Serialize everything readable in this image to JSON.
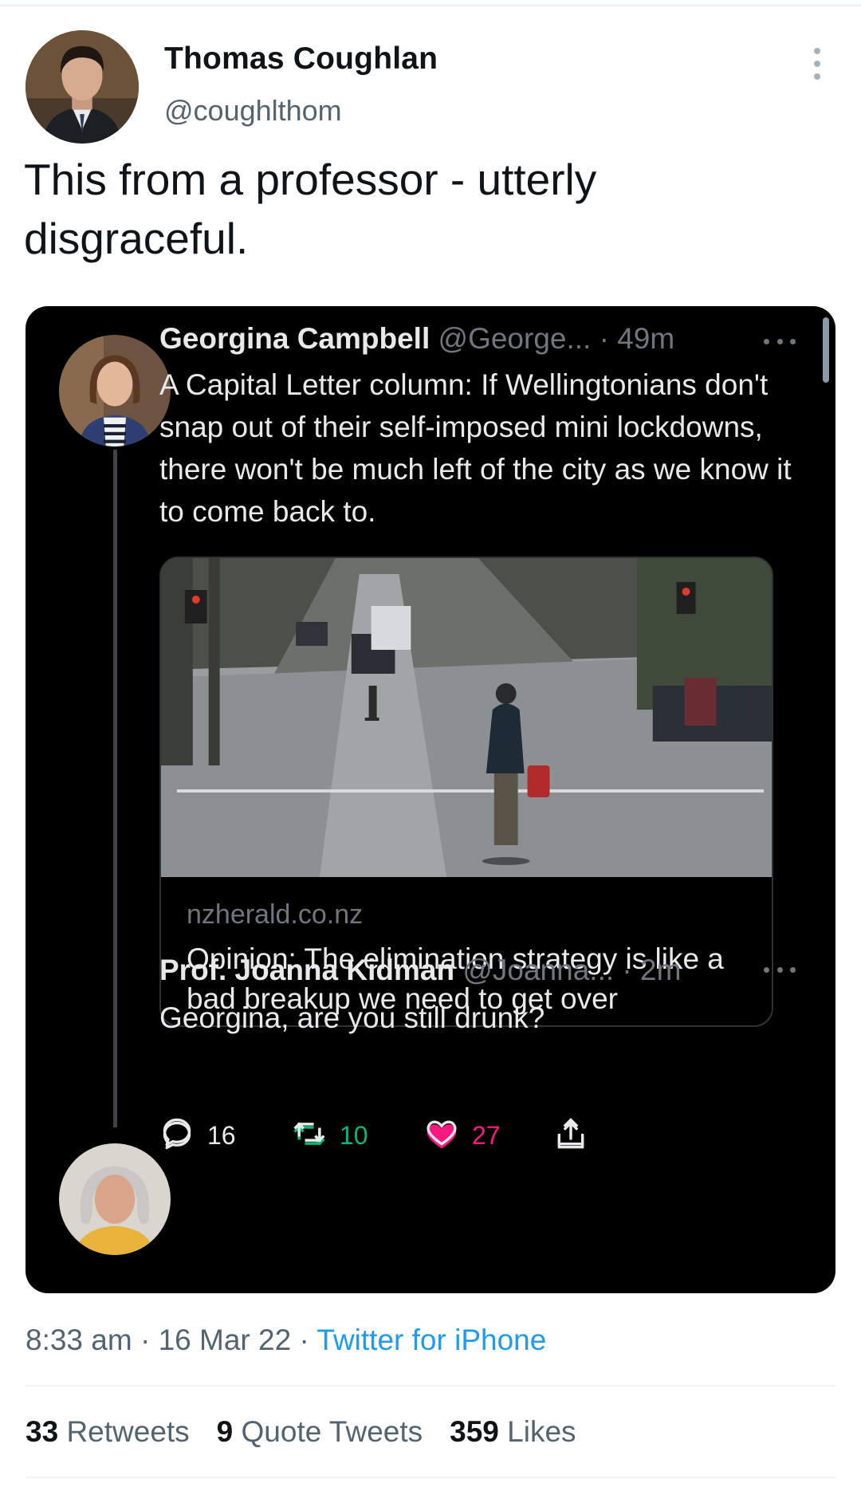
{
  "tweet": {
    "author_name": "Thomas Coughlan",
    "author_handle": "@coughlthom",
    "text": "This from a professor - utterly disgraceful.",
    "more_icon": "more-vertical-icon"
  },
  "quoted": {
    "tweet1": {
      "name": "Georgina Campbell",
      "handle": "@George...",
      "separator": " · ",
      "time": "49m",
      "text": "A Capital Letter column: If Wellingtonians don't snap out of their self-imposed mini lockdowns, there won't be much left of the city as we know it to come back to.",
      "link": {
        "domain": "nzherald.co.nz",
        "title": "Opinion: The elimination strategy is like a bad breakup we need to get over"
      },
      "actions": {
        "replies": "16",
        "retweets": "10",
        "likes": "27",
        "like_color": "#f91880",
        "retweet_color": "#00ba7c"
      }
    },
    "tweet2": {
      "name": "Prof. Joanna Kidman",
      "handle": "@Joanna...",
      "separator": " · ",
      "time": "2m",
      "text": "Georgina, are you still drunk?"
    }
  },
  "meta": {
    "time": "8:33 am",
    "sep1": " · ",
    "date": "16 Mar 22",
    "sep2": " · ",
    "source": "Twitter for iPhone"
  },
  "stats": {
    "retweets_count": "33",
    "retweets_label": "Retweets",
    "quotes_count": "9",
    "quotes_label": "Quote Tweets",
    "likes_count": "359",
    "likes_label": "Likes"
  }
}
